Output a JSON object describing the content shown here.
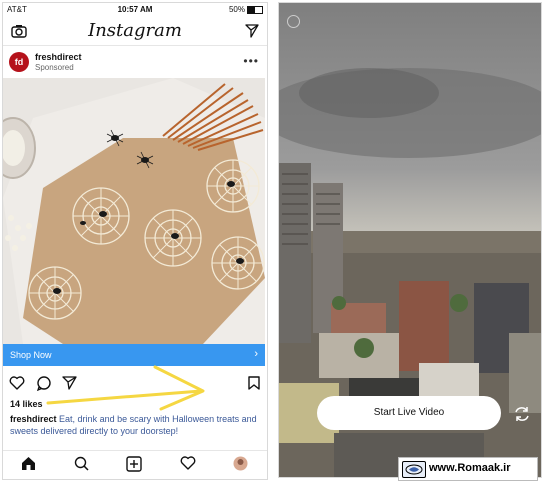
{
  "left_phone": {
    "status": {
      "carrier": "AT&T",
      "time": "10:57 AM",
      "battery": "50%"
    },
    "header": {
      "title": "Instagram"
    },
    "post": {
      "avatar_text": "fd",
      "username": "freshdirect",
      "sponsored": "Sponsored",
      "more": "•••",
      "cta_label": "Shop Now",
      "cta_chevron": "›",
      "likes": "14 likes",
      "caption_user": "freshdirect",
      "caption_text": "Eat, drink and be scary with Halloween treats and sweets delivered directly to your doorstep!"
    }
  },
  "right_phone": {
    "live_button": "Start Live Video"
  },
  "watermark": {
    "text": "www.Romaak.ir"
  },
  "colors": {
    "shop_blue": "#3897f0",
    "arrow_yellow": "#f5d742",
    "brand_red": "#b5121b"
  }
}
